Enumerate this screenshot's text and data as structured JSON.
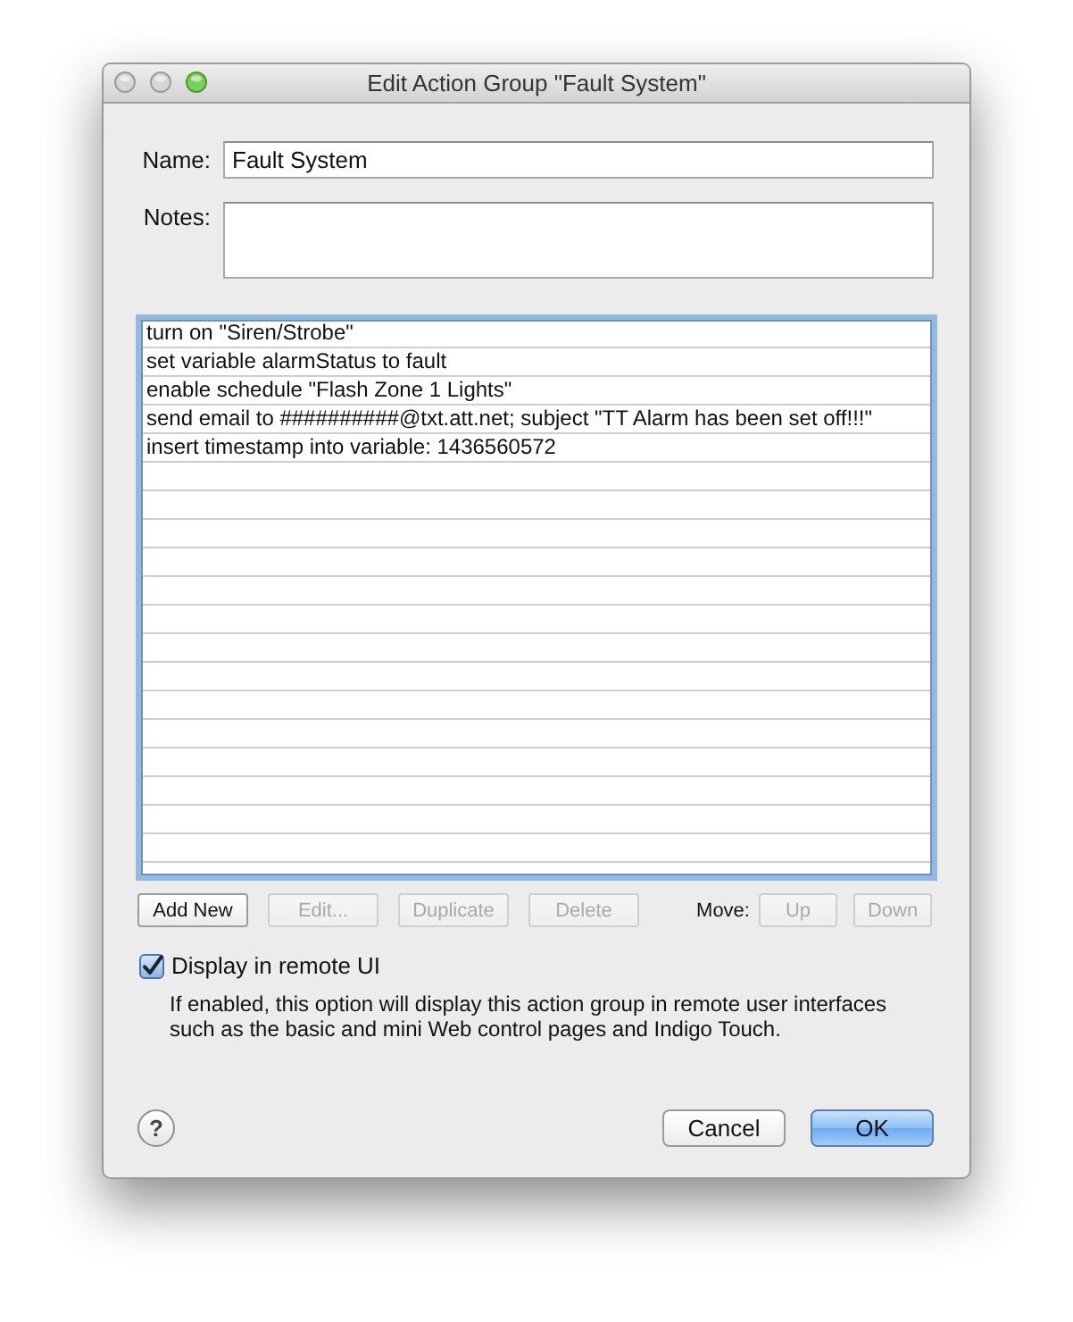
{
  "window": {
    "title": "Edit Action Group \"Fault System\"",
    "controls": [
      {
        "kind": "close",
        "disabled": true
      },
      {
        "kind": "minimize",
        "disabled": true
      },
      {
        "kind": "zoom",
        "disabled": false
      }
    ]
  },
  "name_field": {
    "label": "Name:",
    "value": "Fault System"
  },
  "notes_field": {
    "label": "Notes:"
  },
  "actions": {
    "items": [
      {
        "text": "turn on \"Siren/Strobe\"",
        "selected": false
      },
      {
        "text": "set variable alarmStatus to fault",
        "selected": false
      },
      {
        "text": "enable schedule \"Flash Zone 1 Lights\"",
        "selected": false
      },
      {
        "text": "send email to ##########@txt.att.net; subject \"TT Alarm has been set off!!!\"",
        "selected": false
      },
      {
        "text": "insert timestamp into variable: 1436560572",
        "selected": false
      }
    ]
  },
  "list_buttons": [
    {
      "label": "Add New",
      "disabled": false
    },
    {
      "label": "Edit...",
      "disabled": true
    },
    {
      "label": "Duplicate",
      "disabled": true
    },
    {
      "label": "Delete",
      "disabled": true
    }
  ],
  "move": {
    "label": "Move:",
    "buttons": [
      {
        "label": "Up",
        "disabled": true
      },
      {
        "label": "Down",
        "disabled": true
      }
    ]
  },
  "remote_ui": {
    "label": "Display in remote UI",
    "checked": true,
    "description": "If enabled, this option will display this action group in remote user interfaces such as the basic and mini Web control pages and Indigo Touch."
  },
  "footer": {
    "help": "?",
    "buttons": [
      {
        "label": "Cancel",
        "default": false
      },
      {
        "label": "OK",
        "default": true
      }
    ]
  }
}
